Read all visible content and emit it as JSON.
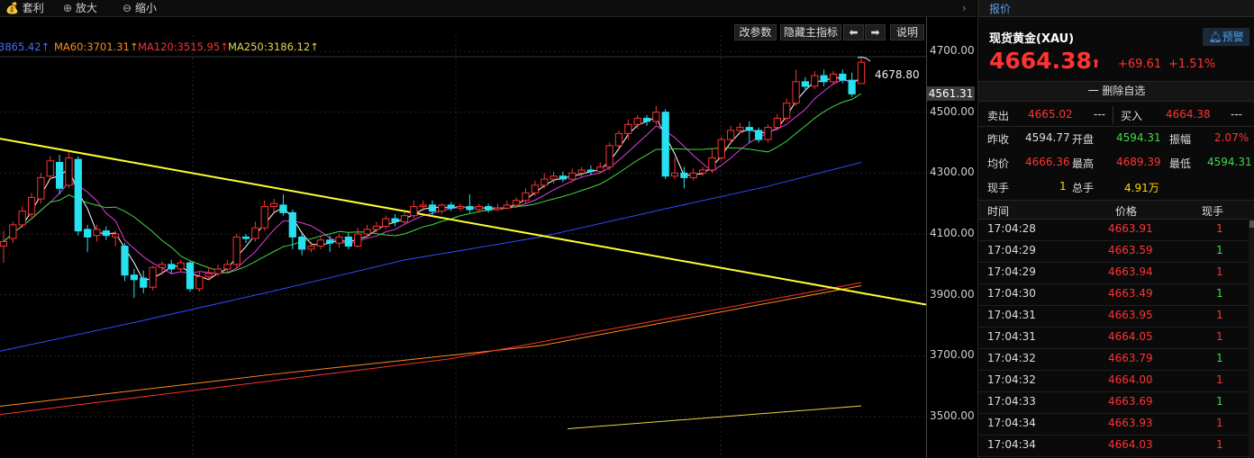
{
  "toolbar": {
    "arbitrage": "套利",
    "zoom_in": "放大",
    "zoom_out": "缩小"
  },
  "chart_controls": {
    "params": "改参数",
    "hide_main": "隐藏主指标",
    "left_arrow": "⬅",
    "right_arrow": "➡",
    "help": "说明"
  },
  "ma_legend": {
    "ma_first": "3865.42↑",
    "ma60": "MA60:3701.31↑",
    "ma120": "MA120:3515.95↑",
    "ma250": "MA250:3186.12↑"
  },
  "chart_data": {
    "type": "candlestick",
    "instrument": "现货黄金(XAU)",
    "ylim": [
      3460,
      4760
    ],
    "yticks": [
      4700.0,
      4500.0,
      4300.0,
      4100.0,
      3900.0,
      3700.0,
      3500.0
    ],
    "ytick_labels": [
      "4700.00",
      "4500.00",
      "4300.00",
      "4100.00",
      "3900.00",
      "3700.00",
      "3500.00"
    ],
    "current_price_tag": "4561.31",
    "high_annotation": "4678.80",
    "colors": {
      "up": "#ff3333",
      "down": "#28e0f0",
      "ma_white": "#ffffff",
      "ma_magenta": "#e040e0",
      "ma_green": "#3fdc3f",
      "ma_blue": "#2f4cff",
      "ma60": "#ff8c1a",
      "ma120": "#ff3030",
      "ma250": "#e8d44d",
      "trend": "#ffff33"
    },
    "candles": [
      [
        4060,
        4075,
        4005,
        4110
      ],
      [
        4085,
        4130,
        4070,
        4140
      ],
      [
        4130,
        4175,
        4120,
        4190
      ],
      [
        4165,
        4220,
        4155,
        4235
      ],
      [
        4215,
        4285,
        4200,
        4300
      ],
      [
        4290,
        4340,
        4280,
        4355
      ],
      [
        4335,
        4250,
        4230,
        4360
      ],
      [
        4260,
        4350,
        4250,
        4370
      ],
      [
        4345,
        4110,
        4095,
        4355
      ],
      [
        4115,
        4090,
        4040,
        4130
      ],
      [
        4095,
        4115,
        4075,
        4130
      ],
      [
        4110,
        4095,
        4080,
        4125
      ],
      [
        4090,
        4100,
        4060,
        4110
      ],
      [
        4060,
        3965,
        3945,
        4070
      ],
      [
        3965,
        3950,
        3890,
        3985
      ],
      [
        3955,
        3925,
        3905,
        3980
      ],
      [
        3925,
        3990,
        3915,
        3995
      ],
      [
        3990,
        4000,
        3965,
        4010
      ],
      [
        4000,
        3985,
        3970,
        4015
      ],
      [
        3985,
        4005,
        3975,
        4015
      ],
      [
        4005,
        3920,
        3910,
        4010
      ],
      [
        3920,
        3960,
        3910,
        3975
      ],
      [
        3960,
        3970,
        3950,
        3990
      ],
      [
        3970,
        3985,
        3960,
        4000
      ],
      [
        3985,
        4000,
        3970,
        4015
      ],
      [
        4000,
        4090,
        3990,
        4100
      ],
      [
        4090,
        4085,
        4070,
        4100
      ],
      [
        4085,
        4120,
        4075,
        4140
      ],
      [
        4120,
        4190,
        4110,
        4210
      ],
      [
        4190,
        4200,
        4170,
        4215
      ],
      [
        4195,
        4170,
        4160,
        4230
      ],
      [
        4170,
        4090,
        4050,
        4180
      ],
      [
        4090,
        4050,
        4030,
        4100
      ],
      [
        4050,
        4060,
        4040,
        4075
      ],
      [
        4060,
        4080,
        4050,
        4095
      ],
      [
        4080,
        4070,
        4040,
        4095
      ],
      [
        4070,
        4090,
        4055,
        4100
      ],
      [
        4090,
        4060,
        4050,
        4105
      ],
      [
        4060,
        4100,
        4055,
        4120
      ],
      [
        4100,
        4115,
        4090,
        4130
      ],
      [
        4115,
        4125,
        4105,
        4140
      ],
      [
        4125,
        4150,
        4115,
        4160
      ],
      [
        4150,
        4140,
        4125,
        4165
      ],
      [
        4140,
        4160,
        4130,
        4170
      ],
      [
        4160,
        4190,
        4150,
        4210
      ],
      [
        4190,
        4195,
        4175,
        4210
      ],
      [
        4195,
        4175,
        4160,
        4210
      ],
      [
        4175,
        4195,
        4165,
        4200
      ],
      [
        4195,
        4185,
        4175,
        4205
      ],
      [
        4185,
        4190,
        4175,
        4200
      ],
      [
        4190,
        4180,
        4170,
        4230
      ],
      [
        4180,
        4190,
        4170,
        4200
      ],
      [
        4190,
        4180,
        4170,
        4200
      ],
      [
        4180,
        4185,
        4175,
        4200
      ],
      [
        4185,
        4195,
        4180,
        4210
      ],
      [
        4195,
        4210,
        4185,
        4220
      ],
      [
        4210,
        4235,
        4200,
        4250
      ],
      [
        4235,
        4260,
        4225,
        4275
      ],
      [
        4260,
        4280,
        4250,
        4300
      ],
      [
        4280,
        4290,
        4265,
        4305
      ],
      [
        4290,
        4280,
        4270,
        4305
      ],
      [
        4280,
        4300,
        4270,
        4315
      ],
      [
        4300,
        4310,
        4285,
        4320
      ],
      [
        4310,
        4305,
        4295,
        4325
      ],
      [
        4305,
        4320,
        4300,
        4335
      ],
      [
        4320,
        4390,
        4310,
        4400
      ],
      [
        4390,
        4430,
        4380,
        4440
      ],
      [
        4430,
        4460,
        4410,
        4475
      ],
      [
        4460,
        4480,
        4445,
        4490
      ],
      [
        4480,
        4470,
        4455,
        4490
      ],
      [
        4470,
        4500,
        4460,
        4520
      ],
      [
        4500,
        4290,
        4280,
        4510
      ],
      [
        4290,
        4300,
        4280,
        4350
      ],
      [
        4300,
        4285,
        4250,
        4320
      ],
      [
        4285,
        4300,
        4275,
        4315
      ],
      [
        4300,
        4310,
        4290,
        4320
      ],
      [
        4310,
        4350,
        4300,
        4380
      ],
      [
        4350,
        4410,
        4340,
        4420
      ],
      [
        4410,
        4440,
        4395,
        4455
      ],
      [
        4440,
        4450,
        4430,
        4465
      ],
      [
        4450,
        4440,
        4400,
        4470
      ],
      [
        4440,
        4410,
        4400,
        4450
      ],
      [
        4410,
        4450,
        4400,
        4460
      ],
      [
        4450,
        4480,
        4440,
        4495
      ],
      [
        4480,
        4530,
        4470,
        4545
      ],
      [
        4530,
        4600,
        4520,
        4640
      ],
      [
        4600,
        4585,
        4570,
        4615
      ],
      [
        4585,
        4620,
        4575,
        4635
      ],
      [
        4620,
        4600,
        4585,
        4640
      ],
      [
        4600,
        4625,
        4590,
        4635
      ],
      [
        4625,
        4605,
        4595,
        4640
      ],
      [
        4605,
        4560,
        4550,
        4630
      ],
      [
        4594,
        4664,
        4594,
        4679
      ]
    ]
  },
  "quote": {
    "tab": "报价",
    "name": "现货黄金(XAU)",
    "alert_btn": "预警",
    "price": "4664.38",
    "arrow": "⬆",
    "change": "+69.61",
    "change_pct": "+1.51%",
    "delete_fav": "一 删除自选",
    "sell_label": "卖出",
    "sell": "4665.02",
    "sell_vol": "---",
    "buy_label": "买入",
    "buy": "4664.38",
    "buy_vol": "---",
    "prev_close_label": "昨收",
    "prev_close": "4594.77",
    "open_label": "开盘",
    "open": "4594.31",
    "amp_label": "振幅",
    "amp": "2.07%",
    "avg_label": "均价",
    "avg": "4666.36",
    "high_label": "最高",
    "high": "4689.39",
    "low_label": "最低",
    "low": "4594.31",
    "hand_label": "现手",
    "hand": "1",
    "total_label": "总手",
    "total": "4.91万"
  },
  "trades": {
    "col_time": "时间",
    "col_price": "价格",
    "col_vol": "现手",
    "rows": [
      {
        "time": "17:04:28",
        "price": "4663.91",
        "vol": "1",
        "vol_color": "#ff3333"
      },
      {
        "time": "17:04:29",
        "price": "4663.59",
        "vol": "1",
        "vol_color": "#3fdc3f"
      },
      {
        "time": "17:04:29",
        "price": "4663.94",
        "vol": "1",
        "vol_color": "#ff3333"
      },
      {
        "time": "17:04:30",
        "price": "4663.49",
        "vol": "1",
        "vol_color": "#3fdc3f"
      },
      {
        "time": "17:04:31",
        "price": "4663.95",
        "vol": "1",
        "vol_color": "#ff3333"
      },
      {
        "time": "17:04:31",
        "price": "4664.05",
        "vol": "1",
        "vol_color": "#ff3333"
      },
      {
        "time": "17:04:32",
        "price": "4663.79",
        "vol": "1",
        "vol_color": "#3fdc3f"
      },
      {
        "time": "17:04:32",
        "price": "4664.00",
        "vol": "1",
        "vol_color": "#ff3333"
      },
      {
        "time": "17:04:33",
        "price": "4663.69",
        "vol": "1",
        "vol_color": "#3fdc3f"
      },
      {
        "time": "17:04:34",
        "price": "4663.93",
        "vol": "1",
        "vol_color": "#ff3333"
      },
      {
        "time": "17:04:34",
        "price": "4664.03",
        "vol": "1",
        "vol_color": "#ff3333"
      }
    ]
  }
}
